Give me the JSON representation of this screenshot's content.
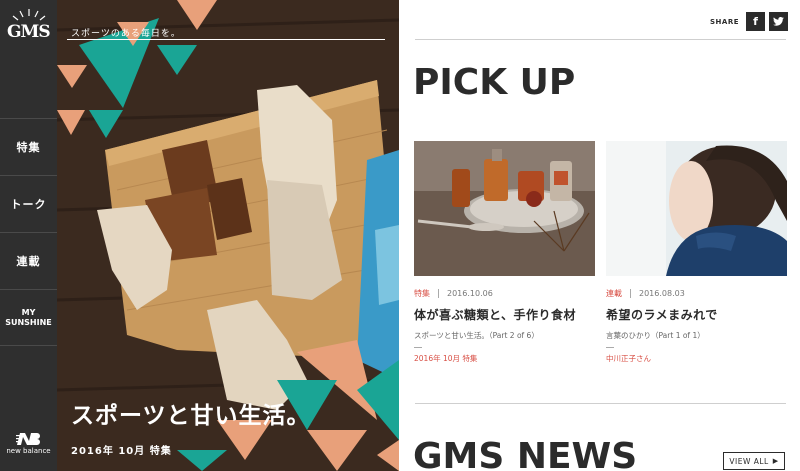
{
  "brand": {
    "logo_text": "GMS",
    "footer_logo": "new balance"
  },
  "nav": [
    {
      "label": "特集"
    },
    {
      "label": "トーク"
    },
    {
      "label": "連載"
    },
    {
      "label_line1": "MY",
      "label_line2": "SUNSHINE"
    }
  ],
  "hero": {
    "tagline": "スポーツのある毎日を。",
    "title": "スポーツと甘い生活。",
    "meta": "2016年 10月 特集"
  },
  "share": {
    "label": "SHARE",
    "facebook": "f",
    "twitter": "twitter-icon"
  },
  "pickup": {
    "heading": "PICK UP",
    "cards": [
      {
        "category": "特集",
        "date": "2016.10.06",
        "title": "体が喜ぶ糖類と、手作り食材",
        "subtitle": "スポーツと甘い生活。（Part 2 of 6）",
        "author": "2016年 10月 特集"
      },
      {
        "category": "連載",
        "date": "2016.08.03",
        "title": "希望のラメまみれで",
        "subtitle": "言葉のひかり（Part 1 of 1）",
        "author": "中川正子さん"
      }
    ]
  },
  "news": {
    "heading": "GMS NEWS",
    "view_all": "VIEW ALL"
  },
  "colors": {
    "accent_teal": "#1aa595",
    "accent_peach": "#e8a07a",
    "category_red": "#d84f45",
    "sidebar": "#2f2f2f"
  }
}
